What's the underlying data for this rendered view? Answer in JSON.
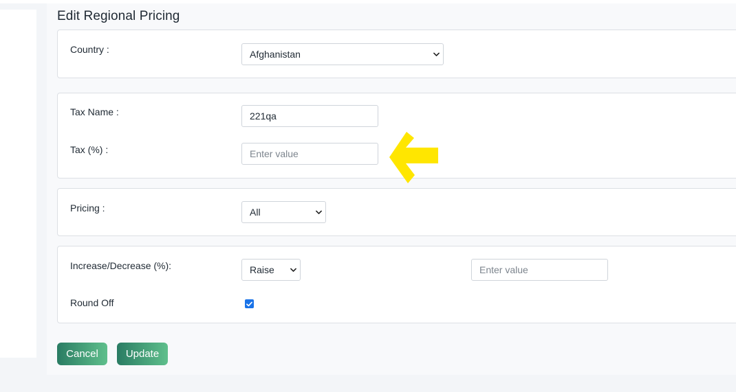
{
  "page": {
    "title": "Edit Regional Pricing"
  },
  "country": {
    "label": "Country :",
    "selected": "Afghanistan"
  },
  "tax": {
    "name_label": "Tax Name :",
    "name_value": "221qa",
    "percent_label": "Tax (%) :",
    "percent_placeholder": "Enter value"
  },
  "pricing": {
    "label": "Pricing :",
    "selected": "All"
  },
  "adjustment": {
    "label": "Increase/Decrease (%):",
    "mode_selected": "Raise",
    "value_placeholder": "Enter value",
    "round_off_label": "Round Off",
    "round_off_checked": true
  },
  "actions": {
    "cancel_label": "Cancel",
    "update_label": "Update"
  },
  "colors": {
    "accent": "#1a73e8",
    "button": "#3a9a76",
    "annotation_arrow": "#ffe600"
  },
  "icons": {
    "select": "chevron-down-icon",
    "check": "check-icon",
    "annotation": "arrow-left-icon"
  }
}
